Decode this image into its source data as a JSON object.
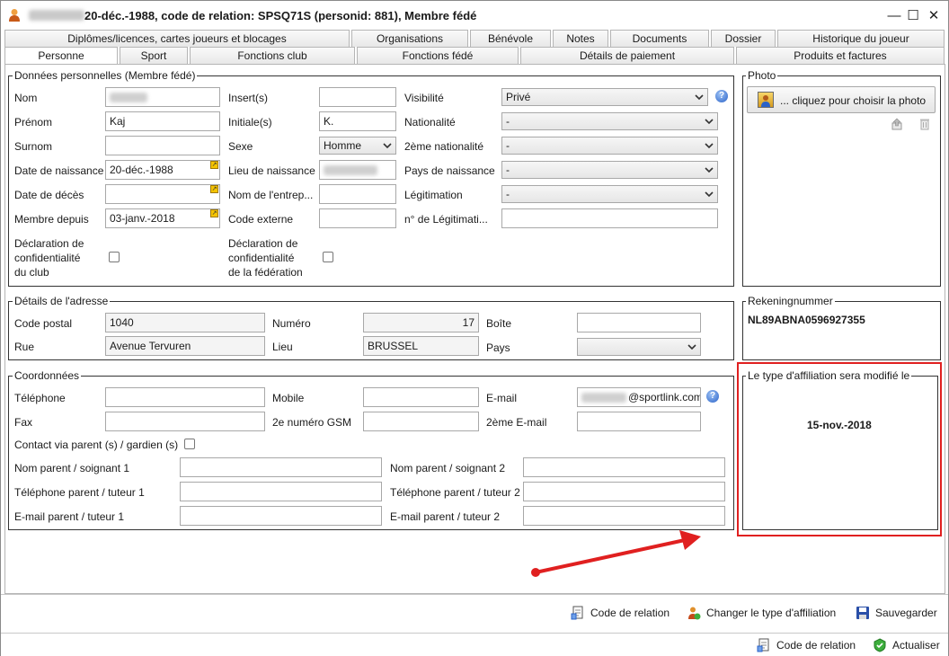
{
  "window": {
    "title": "20-déc.-1988, code de relation: SPSQ71S (personid: 881), Membre fédé",
    "min_label": "—",
    "max_label": "☐",
    "close_label": "✕"
  },
  "tabs_row1": [
    {
      "label": "Diplômes/licences, cartes joueurs et blocages"
    },
    {
      "label": "Organisations"
    },
    {
      "label": "Bénévole"
    },
    {
      "label": "Notes"
    },
    {
      "label": "Documents"
    },
    {
      "label": "Dossier"
    },
    {
      "label": "Historique du joueur"
    }
  ],
  "tabs_row2": [
    {
      "label": "Personne",
      "active": true
    },
    {
      "label": "Sport"
    },
    {
      "label": "Fonctions club"
    },
    {
      "label": "Fonctions fédé"
    },
    {
      "label": "Détails de paiement"
    },
    {
      "label": "Produits et factures"
    }
  ],
  "personal": {
    "legend": "Données personnelles (Membre fédé)",
    "nom_label": "Nom",
    "prenom_label": "Prénom",
    "prenom_value": "Kaj",
    "surnom_label": "Surnom",
    "dob_label": "Date de naissance",
    "dob_value": "20-déc.-1988",
    "dod_label": "Date de décès",
    "member_since_label": "Membre depuis",
    "member_since_value": "03-janv.-2018",
    "privacy_club_label_1": "Déclaration de",
    "privacy_club_label_2": "confidentialité",
    "privacy_club_label_3": "du club",
    "insert_label": "Insert(s)",
    "initials_label": "Initiale(s)",
    "initials_value": "K.",
    "sexe_label": "Sexe",
    "sexe_value": "Homme",
    "birthplace_label": "Lieu de naissance",
    "company_label": "Nom de l'entrep...",
    "external_code_label": "Code externe",
    "privacy_fed_label_1": "Déclaration de",
    "privacy_fed_label_2": "confidentialité",
    "privacy_fed_label_3": "de la fédération",
    "visibility_label": "Visibilité",
    "visibility_value": "Privé",
    "nationality_label": "Nationalité",
    "nationality_value": "-",
    "nationality2_label": "2ème nationalité",
    "nationality2_value": "-",
    "birth_country_label": "Pays de naissance",
    "birth_country_value": "-",
    "legitimation_label": "Légitimation",
    "legitimation_value": "-",
    "legitimation_no_label": "n° de Légitimati..."
  },
  "photo": {
    "legend": "Photo",
    "button_label": "... cliquez pour choisir la photo"
  },
  "address": {
    "legend": "Détails de l'adresse",
    "postal_label": "Code postal",
    "postal_value": "1040",
    "street_label": "Rue",
    "street_value": "Avenue Tervuren",
    "number_label": "Numéro",
    "number_value": "17",
    "place_label": "Lieu",
    "place_value": "BRUSSEL",
    "box_label": "Boîte",
    "country_label": "Pays"
  },
  "bank": {
    "legend": "Rekeningnummer",
    "value": "NL89ABNA0596927355"
  },
  "contact": {
    "legend": "Coordonnées",
    "phone_label": "Téléphone",
    "fax_label": "Fax",
    "mobile_label": "Mobile",
    "gsm2_label": "2e numéro GSM",
    "email_label": "E-mail",
    "email_value": "@sportlink.com",
    "email2_label": "2ème E-mail",
    "via_parent_label": "Contact via parent (s) / gardien (s)",
    "parent1_name_label": "Nom parent / soignant 1",
    "parent1_phone_label": "Téléphone parent / tuteur 1",
    "parent1_email_label": "E-mail parent / tuteur 1",
    "parent2_name_label": "Nom parent / soignant 2",
    "parent2_phone_label": "Téléphone parent / tuteur 2",
    "parent2_email_label": "E-mail parent / tuteur 2"
  },
  "affiliation": {
    "legend": "Le type d'affiliation sera modifié le",
    "date": "15-nov.-2018"
  },
  "footer": {
    "relation_code_label": "Code de relation",
    "change_type_label": "Changer le type d'affiliation",
    "save_label": "Sauvegarder",
    "relation_code2_label": "Code de relation",
    "refresh_label": "Actualiser"
  },
  "colors": {
    "highlight_red": "#e02020",
    "tab_border": "#b5b5b5"
  }
}
